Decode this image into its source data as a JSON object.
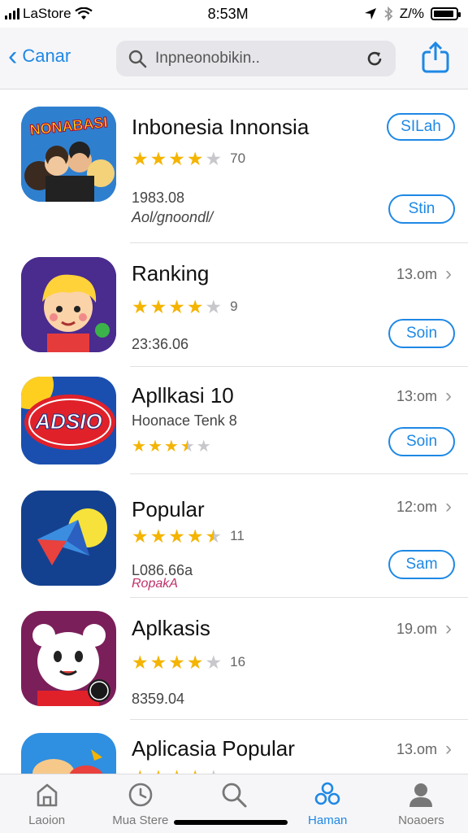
{
  "status_bar": {
    "carrier": "LaStore",
    "time": "8:53M",
    "battery": "Z/%"
  },
  "nav": {
    "back_label": "Canar",
    "search_placeholder": "Inpneonobikin.."
  },
  "apps": [
    {
      "title": "Inbonesia Innonsia",
      "icon_text": "NONABASI",
      "icon_name": "cartoon-group-icon",
      "stars": 4,
      "rating_count": "70",
      "meta1": "1983.08",
      "meta2": "Aol/gnoondl/",
      "pill_top": "SILah",
      "pill_bottom": "Stin"
    },
    {
      "title": "Ranking",
      "icon_name": "cartoon-boy-icon",
      "stars": 4,
      "rating_count": "9",
      "size": "13.om",
      "meta1": "23:36.06",
      "pill_bottom": "Soin"
    },
    {
      "title": "Apllkasi 10",
      "icon_text": "ADSIO",
      "icon_name": "red-badge-icon",
      "stars": 3.5,
      "rating_count": "",
      "size": "13:om",
      "meta1": "Hoonace Tenk 8",
      "pill_bottom": "Soin"
    },
    {
      "title": "Popular",
      "icon_name": "paper-plane-icon",
      "stars": 4.5,
      "rating_count": "11",
      "size": "12:om",
      "meta1": "L086.66a",
      "meta2": "RopakA",
      "pill_bottom": "Sam"
    },
    {
      "title": "Aplkasis",
      "icon_name": "bear-mascot-icon",
      "stars": 4,
      "rating_count": "16",
      "size": "19.om",
      "meta1": "8359.04"
    },
    {
      "title": "Aplicasia Popular",
      "icon_name": "colorful-app-icon",
      "stars": 4,
      "rating_count": "",
      "size": "13.om"
    }
  ],
  "tabs": [
    {
      "label": "Laoion",
      "icon": "home-icon"
    },
    {
      "label": "Mua Stere",
      "icon": "clock-icon"
    },
    {
      "label": "",
      "icon": "search-icon"
    },
    {
      "label": "Haman",
      "icon": "apps-icon"
    },
    {
      "label": "Noaoers",
      "icon": "person-icon"
    }
  ],
  "colors": {
    "accent": "#1e88e5",
    "star": "#f4b400"
  }
}
